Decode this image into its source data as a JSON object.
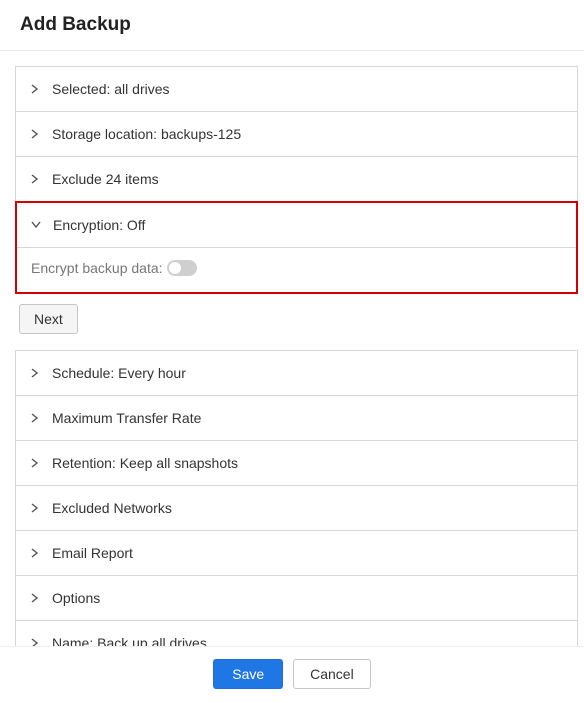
{
  "dialog": {
    "title": "Add Backup"
  },
  "sections": {
    "selected": {
      "label": "Selected: all drives"
    },
    "storage": {
      "label": "Storage location: backups-125"
    },
    "exclude": {
      "label": "Exclude 24 items"
    },
    "encryption": {
      "label": "Encryption: Off"
    },
    "schedule": {
      "label": "Schedule: Every hour"
    },
    "transfer": {
      "label": "Maximum Transfer Rate"
    },
    "retention": {
      "label": "Retention: Keep all snapshots"
    },
    "networks": {
      "label": "Excluded Networks"
    },
    "email": {
      "label": "Email Report"
    },
    "options": {
      "label": "Options"
    },
    "name": {
      "label": "Name: Back up all drives"
    }
  },
  "encryption_panel": {
    "label": "Encrypt backup data:",
    "toggle_on": false
  },
  "buttons": {
    "next": "Next",
    "save": "Save",
    "cancel": "Cancel"
  }
}
